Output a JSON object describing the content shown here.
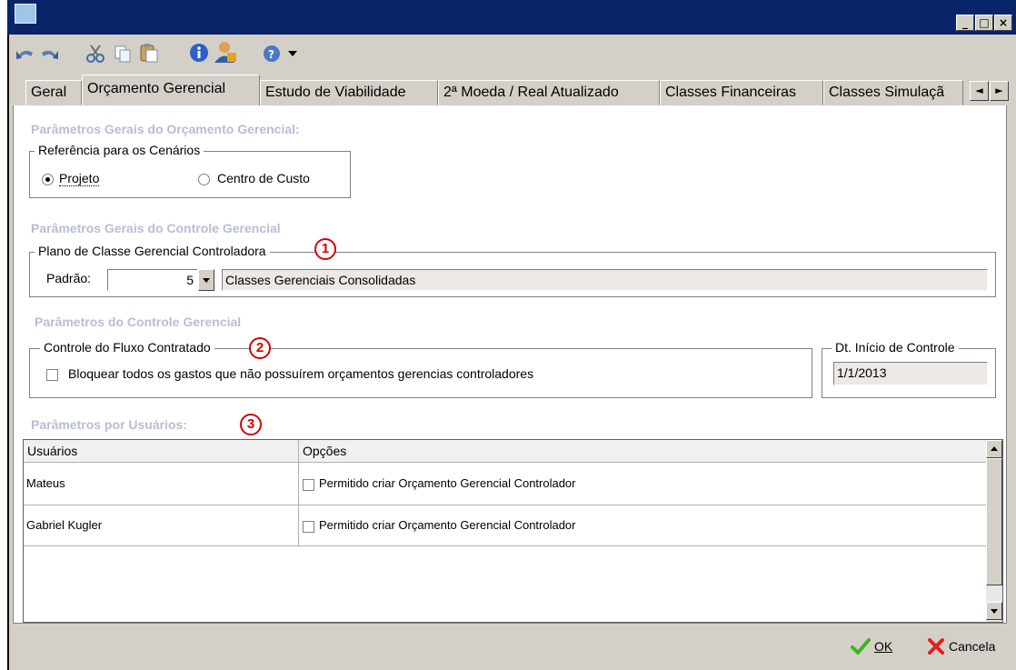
{
  "window": {
    "controls": {
      "minimize": "_",
      "maximize": "□",
      "close": "×"
    }
  },
  "toolbar": {
    "icons": [
      "undo-icon",
      "redo-icon",
      "cut-icon",
      "copy-icon",
      "paste-icon",
      "info-icon",
      "user-icon",
      "help-icon",
      "dropdown-arrow-icon"
    ]
  },
  "tabs": [
    {
      "label": "Geral"
    },
    {
      "label": "Orçamento Gerencial"
    },
    {
      "label": "Estudo de Viabilidade"
    },
    {
      "label": "2ª Moeda / Real Atualizado"
    },
    {
      "label": "Classes Financeiras"
    },
    {
      "label": "Classes Simulaçã"
    }
  ],
  "tab_scroll": {
    "left": "◄",
    "right": "►"
  },
  "section1": {
    "title": "Parâmetros Gerais do Orçamento Gerencial:",
    "group_label": "Referência para os Cenários",
    "radio_projeto": "Projeto",
    "radio_centro": "Centro de Custo",
    "selected": "Projeto"
  },
  "section2": {
    "title": "Parâmetros Gerais do Controle Gerencial",
    "group_label": "Plano de Classe Gerencial Controladora",
    "badge": "1",
    "padrao_label": "Padrão:",
    "padrao_value": "5",
    "padrao_desc": "Classes Gerenciais Consolidadas"
  },
  "section3": {
    "title": "Parâmetros do Controle Gerencial",
    "group_label": "Controle do Fluxo Contratado",
    "badge": "2",
    "checkbox_label": "Bloquear todos os gastos que não possuírem orçamentos gerencias controladores",
    "checked": false,
    "date_group_label": "Dt. Início de Controle",
    "date_value": "1/1/2013"
  },
  "section4": {
    "title": "Parâmetros por Usuários:",
    "badge": "3",
    "columns": [
      "Usuários",
      "Opções"
    ],
    "rows": [
      {
        "user": "Mateus",
        "option": "Permitido criar Orçamento Gerencial Controlador",
        "checked": false
      },
      {
        "user": "Gabriel Kugler",
        "option": "Permitido criar Orçamento Gerencial Controlador",
        "checked": false
      }
    ]
  },
  "buttons": {
    "ok": "OK",
    "cancel": "Cancela"
  },
  "colors": {
    "titlebar": "#0a246a",
    "section_title": "#b8bcd8",
    "badge": "#d40000",
    "ok_check": "#3cb521",
    "cancel_x": "#e02020"
  }
}
